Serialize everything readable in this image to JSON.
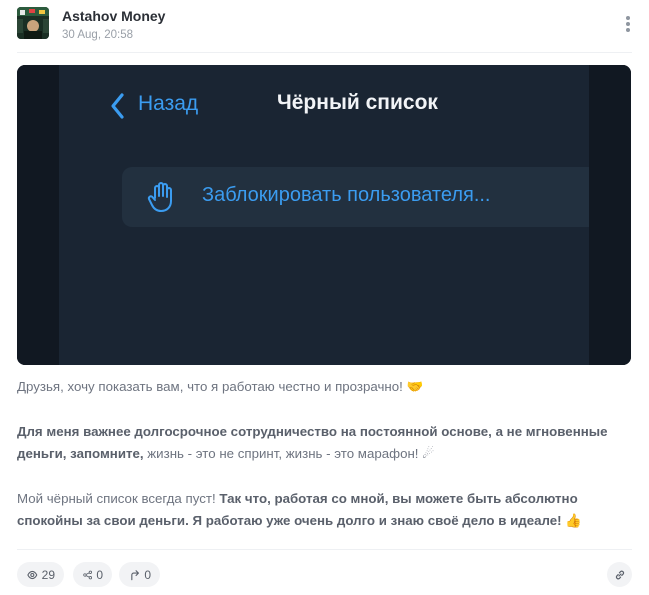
{
  "post": {
    "author": "Astahov Money",
    "date": "30 Aug, 20:58",
    "avatar_icon": "avatar-image",
    "more_icon": "more-vertical-icon"
  },
  "image": {
    "back_label": "Назад",
    "title": "Чёрный список",
    "block_label": "Заблокировать пользователя...",
    "accent_color": "#3b9cf0",
    "background_color": "#1a2533"
  },
  "text": {
    "p1": "Друзья, хочу показать вам, что я работаю честно и прозрачно!",
    "p1_emoji": "🤝",
    "p2_bold": "Для меня важнее долгосрочное сотрудничество на постоянной основе, а не мгновенные деньги, запомните,",
    "p2_rest": " жизнь - это не спринт, жизнь - это марафон!",
    "p2_emoji": "☄",
    "p3_start": "Мой чёрный список всегда пуст!",
    "p3_bold": " Так что, работая со мной, вы можете быть абсолютно спокойны за свои деньги. Я работаю уже очень долго и знаю своё дело в идеале!",
    "p3_emoji": "👍"
  },
  "footer": {
    "views": "29",
    "shares": "0",
    "reposts": "0",
    "views_icon": "eye-icon",
    "shares_icon": "share-icon",
    "reposts_icon": "repost-icon",
    "link_icon": "link-icon"
  }
}
